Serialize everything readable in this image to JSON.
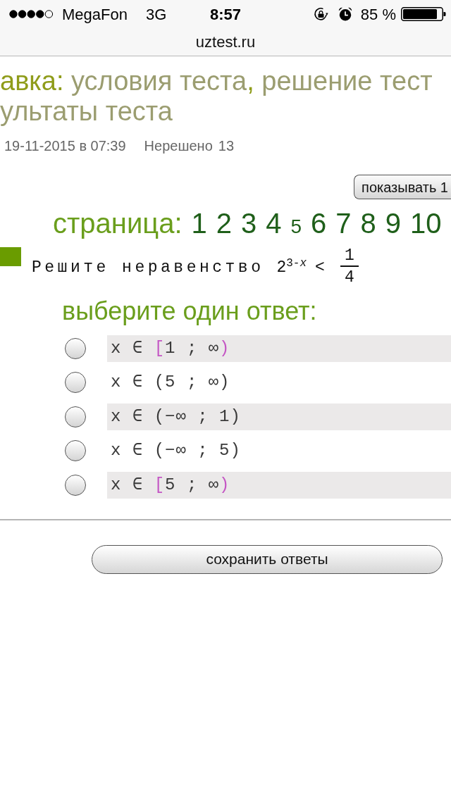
{
  "status_bar": {
    "carrier": "MegaFon",
    "network": "3G",
    "time": "8:57",
    "battery": "85 %"
  },
  "address_bar": {
    "url": "uztest.ru"
  },
  "title": {
    "parts": [
      {
        "kind": "label",
        "text": "авка:"
      },
      {
        "kind": "link",
        "text": "условия теста"
      },
      {
        "kind": "separator",
        "text": ","
      },
      {
        "kind": "link",
        "text": "решение тест"
      },
      {
        "kind": "link",
        "text": "ультаты теста"
      }
    ]
  },
  "meta": {
    "date": "19-11-2015 в 07:39",
    "unsolved_label": "Нерешено",
    "unsolved_count": "13"
  },
  "show_button": {
    "label": "показывать 1"
  },
  "pagination": {
    "label": "страница:",
    "pages": [
      {
        "label": "1",
        "selected": false
      },
      {
        "label": "2",
        "selected": false
      },
      {
        "label": "3",
        "selected": false
      },
      {
        "label": "4",
        "selected": false
      },
      {
        "label": "5",
        "selected": true
      },
      {
        "label": "6",
        "selected": false
      },
      {
        "label": "7",
        "selected": false
      },
      {
        "label": "8",
        "selected": false
      },
      {
        "label": "9",
        "selected": false
      },
      {
        "label": "10",
        "selected": false
      }
    ]
  },
  "question": {
    "text": "Решите неравенство",
    "base": "2",
    "exponent": "3-*x*",
    "relation": "<",
    "numerator": "1",
    "denominator": "4"
  },
  "answer_prompt": "выберите один ответ:",
  "options": [
    {
      "variable": "x ∈",
      "open": "[",
      "inner": "1 ; ∞",
      "close": ")",
      "brackets_highlighted": true,
      "selected": false
    },
    {
      "variable": "x ∈",
      "open": "(",
      "inner": "5 ; ∞",
      "close": ")",
      "brackets_highlighted": false,
      "selected": false
    },
    {
      "variable": "x ∈",
      "open": "(",
      "inner": "−∞ ; 1",
      "close": ")",
      "brackets_highlighted": false,
      "selected": false
    },
    {
      "variable": "x ∈",
      "open": "(",
      "inner": "−∞ ; 5",
      "close": ")",
      "brackets_highlighted": false,
      "selected": false
    },
    {
      "variable": "x ∈",
      "open": "[",
      "inner": "5 ; ∞",
      "close": ")",
      "brackets_highlighted": true,
      "selected": false
    }
  ],
  "save_button": {
    "label": "сохранить ответы"
  }
}
